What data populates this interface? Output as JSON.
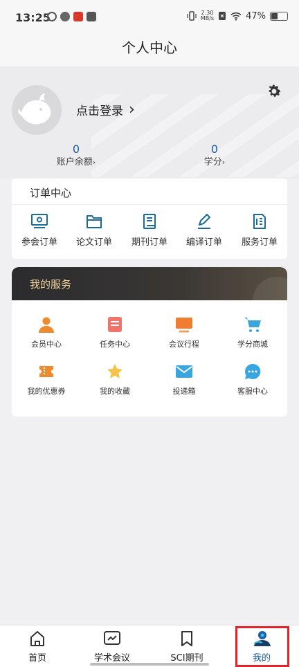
{
  "status_bar": {
    "time": "13:25",
    "speed_top": "2.30",
    "speed_unit": "MB/s",
    "battery": "47%"
  },
  "header": {
    "title": "个人中心"
  },
  "profile": {
    "login_label": "点击登录",
    "login_arrow": "›"
  },
  "stats": [
    {
      "value": "0",
      "label": "账户余额",
      "arrow": "›"
    },
    {
      "value": "0",
      "label": "学分",
      "arrow": "›"
    }
  ],
  "orders": {
    "title": "订单中心",
    "items": [
      {
        "label": "参会订单",
        "icon": "monitor-icon"
      },
      {
        "label": "论文订单",
        "icon": "folder-icon"
      },
      {
        "label": "期刊订单",
        "icon": "book-icon"
      },
      {
        "label": "编译订单",
        "icon": "edit-icon"
      },
      {
        "label": "服务订单",
        "icon": "document-icon"
      }
    ]
  },
  "services": {
    "title": "我的服务",
    "items": [
      {
        "label": "会员中心",
        "icon": "member-icon"
      },
      {
        "label": "任务中心",
        "icon": "task-icon"
      },
      {
        "label": "会议行程",
        "icon": "meeting-icon"
      },
      {
        "label": "学分商城",
        "icon": "cart-icon"
      },
      {
        "label": "我的优惠券",
        "icon": "coupon-icon"
      },
      {
        "label": "我的收藏",
        "icon": "star-icon"
      },
      {
        "label": "投递箱",
        "icon": "mail-icon"
      },
      {
        "label": "客服中心",
        "icon": "chat-icon"
      }
    ]
  },
  "tabbar": [
    {
      "label": "首页",
      "icon": "home-icon"
    },
    {
      "label": "学术会议",
      "icon": "chart-icon"
    },
    {
      "label": "SCI期刊",
      "icon": "bookmark-icon"
    },
    {
      "label": "我的",
      "icon": "profile-icon",
      "active": true
    }
  ],
  "colors": {
    "accent": "#1e5fa6",
    "icon_blue": "#1a6a9a",
    "highlight": "#e0242a",
    "services_title": "#f0d19a"
  }
}
